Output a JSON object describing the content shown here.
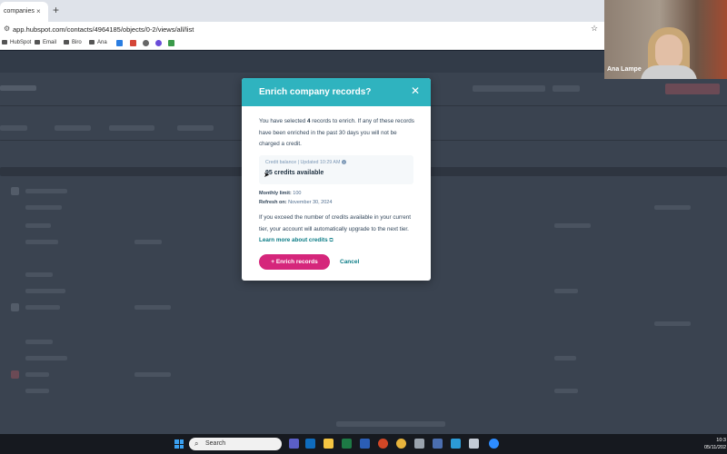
{
  "browser": {
    "tab_title": "companies",
    "tab_close": "×",
    "new_tab": "+",
    "url": "app.hubspot.com/contacts/4964185/objects/0-2/views/all/list",
    "bookmarks": [
      "HubSpot",
      "Email",
      "Biro",
      "Ana"
    ]
  },
  "video": {
    "participant_name": "Ana Lampe"
  },
  "modal": {
    "title": "Enrich company records?",
    "close_glyph": "✕",
    "message_prefix": "You have selected ",
    "selected_count": "4",
    "message_suffix": " records to enrich. If any of these records have been enriched in the past 30 days you will not be charged a credit.",
    "credit_meta": "Credit balance | Updated 10:29 AM",
    "credits_available": "95 credits available",
    "monthly_limit_label": "Monthly limit:",
    "monthly_limit_value": "100",
    "refresh_label": "Refresh on:",
    "refresh_value": "November 30, 2024",
    "exceed_text": "If you exceed the number of credits available in your current tier, your account will automatically upgrade to the next tier. ",
    "learn_more": "Learn more about credits",
    "enrich_button": "+ Enrich records",
    "cancel_button": "Cancel"
  },
  "taskbar": {
    "search_placeholder": "Search",
    "time": "10:3",
    "date": "05/11/202"
  },
  "colors": {
    "modal_header": "#2fb3bf",
    "primary_button": "#d5267b",
    "link": "#0b7c86"
  }
}
